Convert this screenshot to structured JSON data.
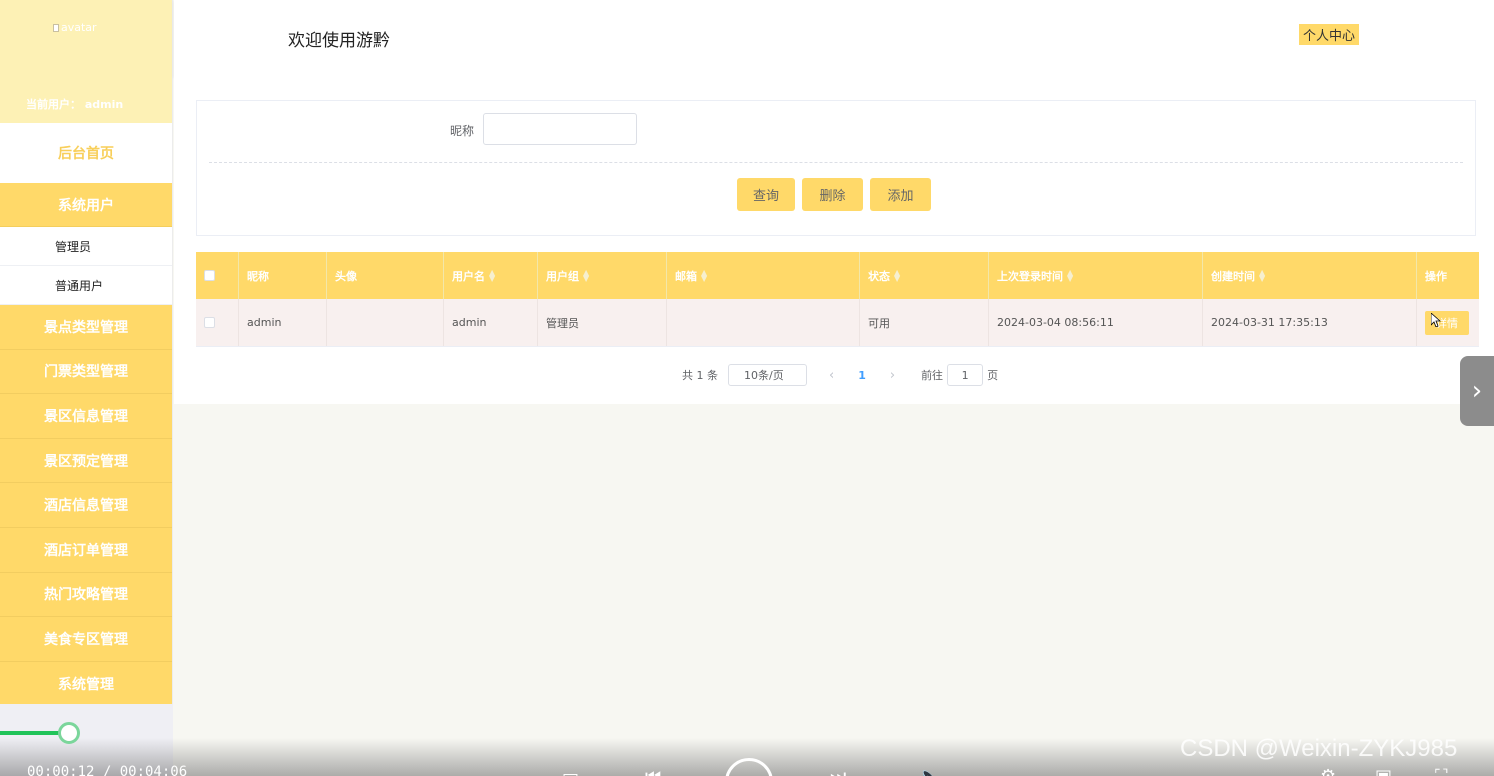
{
  "sidebar": {
    "avatar_alt": "avatar",
    "current_user": "当前用户：  admin",
    "home": "后台首页",
    "group": {
      "label": "系统用户",
      "items": [
        "管理员",
        "普通用户"
      ]
    },
    "menus": [
      "景点类型管理",
      "门票类型管理",
      "景区信息管理",
      "景区预定管理",
      "酒店信息管理",
      "酒店订单管理",
      "热门攻略管理",
      "美食专区管理",
      "系统管理"
    ]
  },
  "header": {
    "welcome": "欢迎使用游黔",
    "personal_center": "个人中心"
  },
  "search": {
    "label": "昵称",
    "value": "",
    "query_btn": "查询",
    "delete_btn": "删除",
    "add_btn": "添加"
  },
  "table": {
    "columns": [
      "昵称",
      "头像",
      "用户名",
      "用户组",
      "邮箱",
      "状态",
      "上次登录时间",
      "创建时间",
      "操作"
    ],
    "rows": [
      {
        "nickname": "admin",
        "avatar": "",
        "username": "admin",
        "group": "管理员",
        "email": "",
        "status": "可用",
        "last_login": "2024-03-04 08:56:11",
        "created": "2024-03-31 17:35:13",
        "action": "详情"
      }
    ]
  },
  "pager": {
    "total": "共 1 条",
    "page_size": "10条/页",
    "current_page": "1",
    "goto_label": "前往",
    "goto_value": "1",
    "page_unit": "页"
  },
  "player": {
    "timecode": "00:00:12 / 00:04:06",
    "progress": 0.049,
    "watermark": "CSDN @Weixin-ZYKJ985"
  },
  "colors": {
    "accent": "#ffd969",
    "sidebar_top": "#fdf1b5",
    "progress": "#21c45a"
  }
}
